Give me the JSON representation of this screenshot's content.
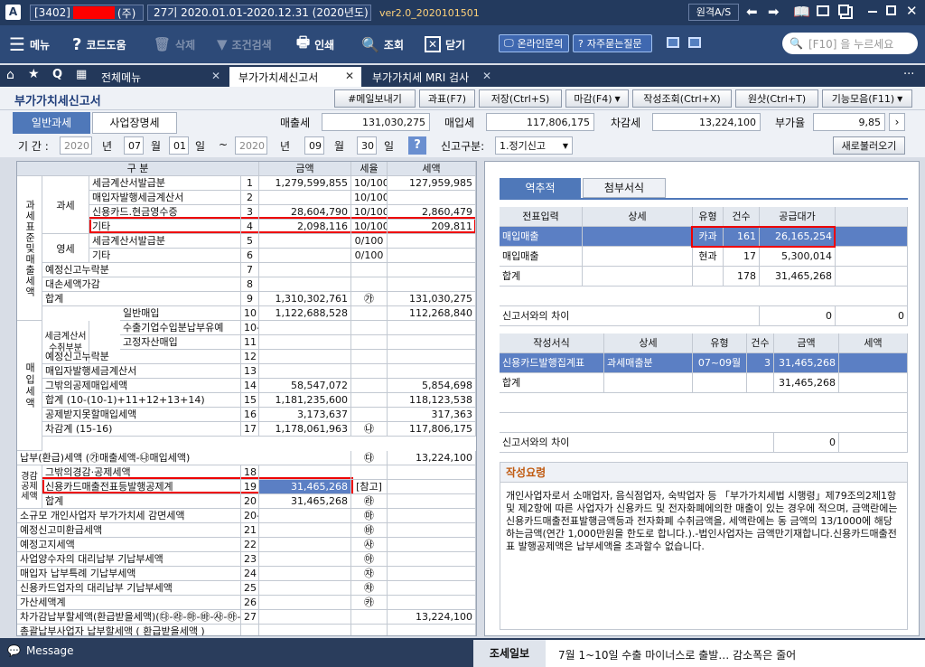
{
  "titlebar": {
    "app_icon": "A",
    "company_code": "[3402]",
    "company_suffix": "(주)",
    "period": "27기  2020.01.01-2020.12.31  (2020년도)",
    "version": "ver2.0_2020101501",
    "remote_label": "원격A/S"
  },
  "toolbar": {
    "menu": "메뉴",
    "code_help": "코드도움",
    "delete": "삭제",
    "condition_search": "조건검색",
    "print": "인쇄",
    "search": "조회",
    "close": "닫기",
    "online_inquiry": "온라인문의",
    "faq": "자주묻는질문",
    "search_placeholder": "[F10] 을 누르세요"
  },
  "tabs": [
    "전체메뉴",
    "부가가치세신고서",
    "부가가치세 MRI 검사"
  ],
  "page_title": "부가가치세신고서",
  "actions": [
    "#메일보내기",
    "과표(F7)",
    "저장(Ctrl+S)",
    "마감(F4)",
    "작성조회(Ctrl+X)",
    "원샷(Ctrl+T)",
    "기능모음(F11)"
  ],
  "subtabs": [
    "일반과세",
    "사업장명세"
  ],
  "summary": {
    "sales_label": "매출세",
    "sales": "131,030,275",
    "purchase_label": "매입세",
    "purchase": "117,806,175",
    "diff_label": "차감세",
    "diff": "13,224,100",
    "vat_label": "부가율",
    "vat": "9,85"
  },
  "period_row": {
    "label": "기 간 :",
    "y1": "2020",
    "m1": "07",
    "d1": "01",
    "y2": "2020",
    "m2": "09",
    "d2": "30",
    "year": "년",
    "month": "월",
    "day": "일",
    "tilde": "~",
    "help": "?",
    "report_type_label": "신고구분:",
    "report_type": "1.정기신고",
    "reload": "새로불러오기"
  },
  "left_table": {
    "headers": [
      "구 분",
      "금액",
      "세율",
      "세액"
    ],
    "sales_group": "과세표준및매출세액",
    "taxable": "과세",
    "zero_rate": "영세",
    "purchase_group": "매입세액",
    "tax_invoice_group": "세금계산서수취부분",
    "deduct_group": "경감공제세액",
    "rows": [
      {
        "label": "세금계산서발급분",
        "no": "1",
        "amt": "1,279,599,855",
        "rate": "10/100",
        "tax": "127,959,985"
      },
      {
        "label": "매입자발행세금계산서",
        "no": "2",
        "amt": "",
        "rate": "10/100",
        "tax": ""
      },
      {
        "label": "신용카드.현금영수증",
        "no": "3",
        "amt": "28,604,790",
        "rate": "10/100",
        "tax": "2,860,479"
      },
      {
        "label": "기타",
        "no": "4",
        "amt": "2,098,116",
        "rate": "10/100",
        "tax": "209,811"
      },
      {
        "label": "세금계산서발급분",
        "no": "5",
        "amt": "",
        "rate": "0/100",
        "tax": ""
      },
      {
        "label": "기타",
        "no": "6",
        "amt": "",
        "rate": "0/100",
        "tax": ""
      },
      {
        "label": "예정신고누락분",
        "no": "7",
        "amt": "",
        "rate": "",
        "tax": ""
      },
      {
        "label": "대손세액가감",
        "no": "8",
        "amt": "",
        "rate": "",
        "tax": ""
      },
      {
        "label": "합계",
        "no": "9",
        "amt": "1,310,302,761",
        "rate": "㉮",
        "tax": "131,030,275"
      },
      {
        "label": "일반매입",
        "no": "10",
        "amt": "1,122,688,528",
        "rate": "",
        "tax": "112,268,840"
      },
      {
        "label": "수출기업수입분납부유예",
        "no": "10-1",
        "amt": "",
        "rate": "",
        "tax": ""
      },
      {
        "label": "고정자산매입",
        "no": "11",
        "amt": "",
        "rate": "",
        "tax": ""
      },
      {
        "label": "예정신고누락분",
        "no": "12",
        "amt": "",
        "rate": "",
        "tax": ""
      },
      {
        "label": "매입자발행세금계산서",
        "no": "13",
        "amt": "",
        "rate": "",
        "tax": ""
      },
      {
        "label": "그밖의공제매입세액",
        "no": "14",
        "amt": "58,547,072",
        "rate": "",
        "tax": "5,854,698"
      },
      {
        "label": "합계 (10-(10-1)+11+12+13+14)",
        "no": "15",
        "amt": "1,181,235,600",
        "rate": "",
        "tax": "118,123,538"
      },
      {
        "label": "공제받지못할매입세액",
        "no": "16",
        "amt": "3,173,637",
        "rate": "",
        "tax": "317,363"
      },
      {
        "label": "차감계 (15-16)",
        "no": "17",
        "amt": "1,178,061,963",
        "rate": "㉯",
        "tax": "117,806,175"
      }
    ],
    "payment": {
      "label": "납부(환급)세액 (㉮매출세액-㉯매입세액)",
      "rate": "㉰",
      "tax": "13,224,100"
    },
    "deduct_rows": [
      {
        "label": "그밖의경감·공제세액",
        "no": "18",
        "amt": "",
        "rate": "",
        "tax": ""
      },
      {
        "label": "신용카드매출전표등발행공제계",
        "no": "19",
        "amt": "31,465,268",
        "rate": "[참고]",
        "tax": ""
      },
      {
        "label": "합계",
        "no": "20",
        "amt": "31,465,268",
        "rate": "㉱",
        "tax": ""
      }
    ],
    "bottom_rows": [
      {
        "label": "소규모 개인사업자 부가가치세 감면세액",
        "no": "20-1",
        "mark": "㉲",
        "tax": ""
      },
      {
        "label": "예정신고미환급세액",
        "no": "21",
        "mark": "㉳",
        "tax": ""
      },
      {
        "label": "예정고지세액",
        "no": "22",
        "mark": "㉴",
        "tax": ""
      },
      {
        "label": "사업양수자의 대리납부 기납부세액",
        "no": "23",
        "mark": "㉵",
        "tax": ""
      },
      {
        "label": "매입자 납부특례 기납부세액",
        "no": "24",
        "mark": "㉶",
        "tax": ""
      },
      {
        "label": "신용카드업자의 대리납부 기납부세액",
        "no": "25",
        "mark": "㉷",
        "tax": ""
      },
      {
        "label": "가산세액계",
        "no": "26",
        "mark": "㉸",
        "tax": ""
      },
      {
        "label": "차가감납부할세액(환급받을세액)(㉰-㉱-㉲-㉳-㉴-㉵-㉶-㉷+㉸)",
        "no": "27",
        "mark": "",
        "tax": "13,224,100"
      },
      {
        "label": "총괄납부사업자 납부할세액 ( 환급받을세액 )",
        "no": "",
        "mark": "",
        "tax": ""
      }
    ]
  },
  "right_panel": {
    "tabs": [
      "역추적",
      "첨부서식"
    ],
    "t1_headers": [
      "전표입력",
      "상세",
      "유형",
      "건수",
      "공급대가"
    ],
    "t1_rows": [
      {
        "a": "매입매출",
        "b": "",
        "c": "카과",
        "d": "161",
        "e": "26,165,254"
      },
      {
        "a": "매입매출",
        "b": "",
        "c": "현과",
        "d": "17",
        "e": "5,300,014"
      },
      {
        "a": "합계",
        "b": "",
        "c": "",
        "d": "178",
        "e": "31,465,268"
      }
    ],
    "t1_diff": {
      "label": "신고서와의 차이",
      "v1": "0",
      "v2": "0"
    },
    "t2_headers": [
      "작성서식",
      "상세",
      "유형",
      "건수",
      "금액",
      "세액"
    ],
    "t2_rows": [
      {
        "a": "신용카드발행집계표",
        "b": "과세매출분",
        "c": "07~09월",
        "d": "3",
        "e": "31,465,268",
        "f": ""
      },
      {
        "a": "합계",
        "b": "",
        "c": "",
        "d": "",
        "e": "31,465,268",
        "f": ""
      }
    ],
    "t2_diff": {
      "label": "신고서와의 차이",
      "v": "0"
    },
    "guide_title": "작성요령",
    "guide_text": "개인사업자로서 소매업자, 음식점업자, 숙박업자 등 「부가가치세법 시행령」제79조의2제1항 및 제2항에 따른 사업자가 신용카드 및 전자화폐에의한 매출이 있는 경우에 적으며, 금액란에는 신용카드매출전표발행금액등과 전자화폐 수취금액을, 세액란에는 동 금액의 13/1000에 해당하는금액(연간 1,000만원을 한도로 합니다.).-법인사업자는 금액만기재합니다.신용카드매출전표 발행공제액은 납부세액을 초과할수 없습니다."
  },
  "statusbar": {
    "message": "Message",
    "news_label": "조세일보",
    "news": "7월 1~10일 수출 마이너스로 출발… 감소폭은 줄어"
  }
}
